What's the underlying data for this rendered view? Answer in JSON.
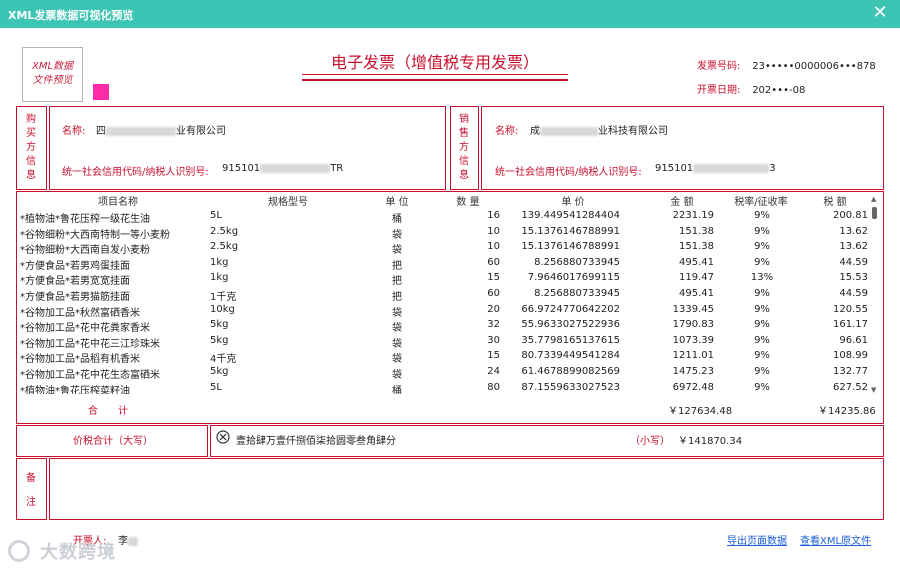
{
  "window": {
    "title": "XML发票数据可视化预览",
    "close_glyph": "✕"
  },
  "badge": {
    "line1": "XML数据",
    "line2": "文件预览"
  },
  "invoice": {
    "title": "电子发票（增值税专用发票）",
    "number_label": "发票号码:",
    "number_value": "23•••••0000006•••878",
    "date_label": "开票日期:",
    "date_value": "202•••-08"
  },
  "buyer": {
    "section": [
      "购",
      "买",
      "方",
      "信",
      "息"
    ],
    "name_label": "名称:",
    "name_value_prefix": "四",
    "name_value_suffix": "业有限公司",
    "tax_label": "统一社会信用代码/纳税人识别号:",
    "tax_value_prefix": "915101",
    "tax_value_suffix": "TR"
  },
  "seller": {
    "section": [
      "销",
      "售",
      "方",
      "信",
      "息"
    ],
    "name_label": "名称:",
    "name_value_prefix": "成",
    "name_value_suffix": "业科技有限公司",
    "tax_label": "统一社会信用代码/纳税人识别号:",
    "tax_value_prefix": "915101",
    "tax_value_suffix": "3"
  },
  "table": {
    "headers": [
      "项目名称",
      "规格型号",
      "单 位",
      "数 量",
      "单 价",
      "金 额",
      "税率/征收率",
      "税 额"
    ],
    "rows": [
      [
        "*植物油*鲁花压榨一级花生油",
        "5L",
        "桶",
        "16",
        "139.449541284404",
        "2231.19",
        "9%",
        "200.81"
      ],
      [
        "*谷物细粉*大西南特制一等小麦粉",
        "2.5kg",
        "袋",
        "10",
        "15.1376146788991",
        "151.38",
        "9%",
        "13.62"
      ],
      [
        "*谷物细粉*大西南自发小麦粉",
        "2.5kg",
        "袋",
        "10",
        "15.1376146788991",
        "151.38",
        "9%",
        "13.62"
      ],
      [
        "*方便食品*若男鸡蛋挂面",
        "1kg",
        "把",
        "60",
        "8.256880733945",
        "495.41",
        "9%",
        "44.59"
      ],
      [
        "*方便食品*若男宽宽挂面",
        "1kg",
        "把",
        "15",
        "7.9646017699115",
        "119.47",
        "13%",
        "15.53"
      ],
      [
        "*方便食品*若男猫筋挂面",
        "1千克",
        "把",
        "60",
        "8.256880733945",
        "495.41",
        "9%",
        "44.59"
      ],
      [
        "*谷物加工品*秋然富硒香米",
        "10kg",
        "袋",
        "20",
        "66.9724770642202",
        "1339.45",
        "9%",
        "120.55"
      ],
      [
        "*谷物加工品*花中花粪家香米",
        "5kg",
        "袋",
        "32",
        "55.9633027522936",
        "1790.83",
        "9%",
        "161.17"
      ],
      [
        "*谷物加工品*花中花三江珍珠米",
        "5kg",
        "袋",
        "30",
        "35.7798165137615",
        "1073.39",
        "9%",
        "96.61"
      ],
      [
        "*谷物加工品*品稻有机香米",
        "4千克",
        "袋",
        "15",
        "80.7339449541284",
        "1211.01",
        "9%",
        "108.99"
      ],
      [
        "*谷物加工品*花中花生态富硒米",
        "5kg",
        "袋",
        "24",
        "61.4678899082569",
        "1475.23",
        "9%",
        "132.77"
      ],
      [
        "*植物油*鲁花压榨菜籽油",
        "5L",
        "桶",
        "80",
        "87.1559633027523",
        "6972.48",
        "9%",
        "627.52"
      ]
    ],
    "total_label": "合　　计",
    "total_amount": "￥127634.48",
    "total_tax": "￥14235.86"
  },
  "sum": {
    "label": "价税合计（大写）",
    "words": "壹拾肆万壹仟捌佰柒拾圆零叁角肆分",
    "small_label": "（小写）",
    "small_value": "￥141870.34"
  },
  "remarks": {
    "section": [
      "备",
      "注"
    ]
  },
  "footer": {
    "issuer_label": "开票人:",
    "issuer_value": "李",
    "export_link": "导出页面数据",
    "view_link": "查看XML原文件"
  },
  "watermark": {
    "text": "大数跨境"
  }
}
